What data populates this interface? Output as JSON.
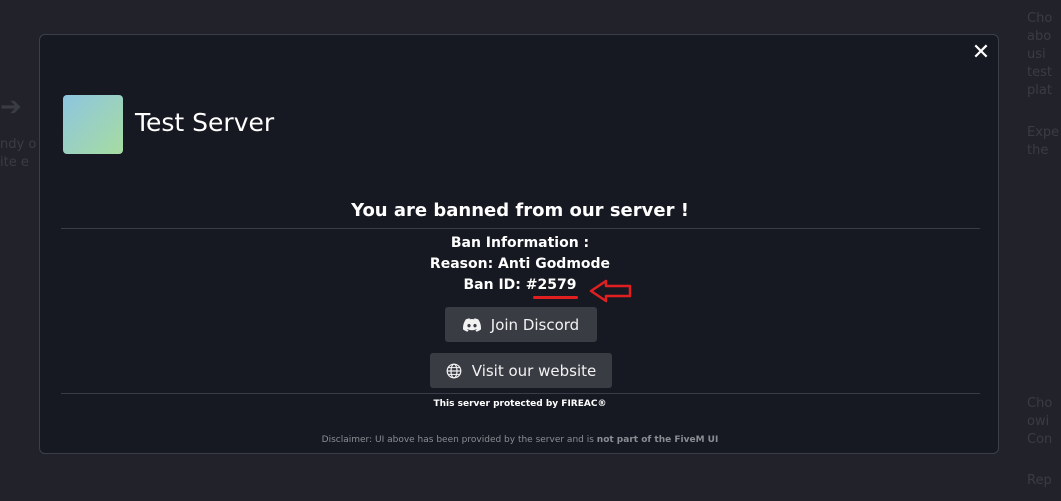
{
  "background": {
    "left_text": "ndy o\nite e",
    "right_top_text": "Cho\nabo\nusi\ntest\nplat",
    "right_mid_text": "Expe\nthe",
    "right_bottom_text": "Cho\nowi\nCon",
    "right_bottom2_text": "Rep"
  },
  "modal": {
    "close_glyph": "✕",
    "server_name": "Test Server",
    "headline": "You are banned from our server !",
    "ban_info_title": "Ban Information :",
    "reason": "Reason: Anti Godmode",
    "ban_id": "Ban ID: #2579",
    "discord_label": "Join Discord",
    "website_label": "Visit our website",
    "protected_text": "This server protected by FIREAC®",
    "disclaimer_prefix": "Disclaimer: UI above has been provided by the server and is ",
    "disclaimer_bold": "not part of the FiveM UI"
  },
  "colors": {
    "annotation": "#e02020",
    "modal_bg": "#171922",
    "button_bg": "#3a3c44"
  },
  "icons": {
    "close": "close-icon",
    "discord": "discord-icon",
    "globe": "globe-icon",
    "annotation_arrow": "left-arrow-annotation"
  }
}
